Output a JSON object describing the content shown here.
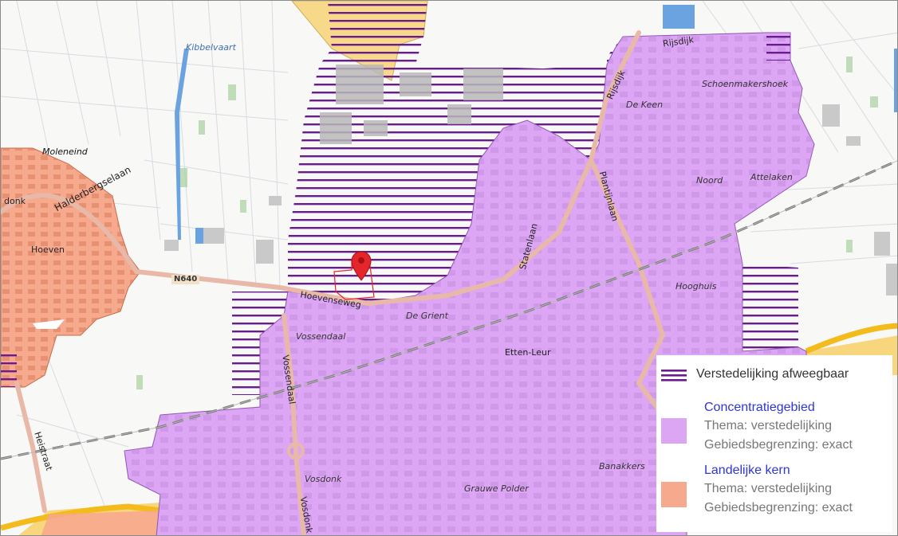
{
  "legend": {
    "item1_label": "Verstedelijking afweegbaar",
    "item2_title": "Concentratiegebied",
    "item2_theme": "Thema: verstedelijking",
    "item2_boundary": "Gebiedsbegrenzing: exact",
    "item3_title": "Landelijke kern",
    "item3_theme": "Thema: verstedelijking",
    "item3_boundary": "Gebiedsbegrenzing: exact",
    "colors": {
      "stripe": "#6a1b8f",
      "concentratiegebied": "#dda6f5",
      "landelijke_kern": "#f7a98e"
    }
  },
  "map_labels": {
    "kibbelvaart": "Kibbelvaart",
    "rijsdijk_top": "Rijsdijk",
    "rijsdijk_side": "Rijsdijk",
    "schoenmakershoek": "Schoenmakershoek",
    "de_keen": "De Keen",
    "moleneind": "Moleneind",
    "halderbergselaan": "Halderbergselaan",
    "donk": "donk",
    "hoeven": "Hoeven",
    "noord": "Noord",
    "attelaken": "Attelaken",
    "plantijnlaan": "Plantijnlaan",
    "statenlaan": "Statenlaan",
    "n640": "N640",
    "hoevenseweg": "Hoevenseweg",
    "de_grient": "De Grient",
    "hooghuis": "Hooghuis",
    "vossendaal": "Vossendaal",
    "vossebdaal": "Vossendaal",
    "etten_leur": "Etten-Leur",
    "heistraat": "Heistraat",
    "vosdonk": "Vosdonk",
    "vosdonk_road": "Vosdonk",
    "grauwe_polder": "Grauwe Polder",
    "banakkers": "Banakkers"
  },
  "marker": {
    "icon": "map-pin-icon",
    "color": "#e3262b"
  }
}
